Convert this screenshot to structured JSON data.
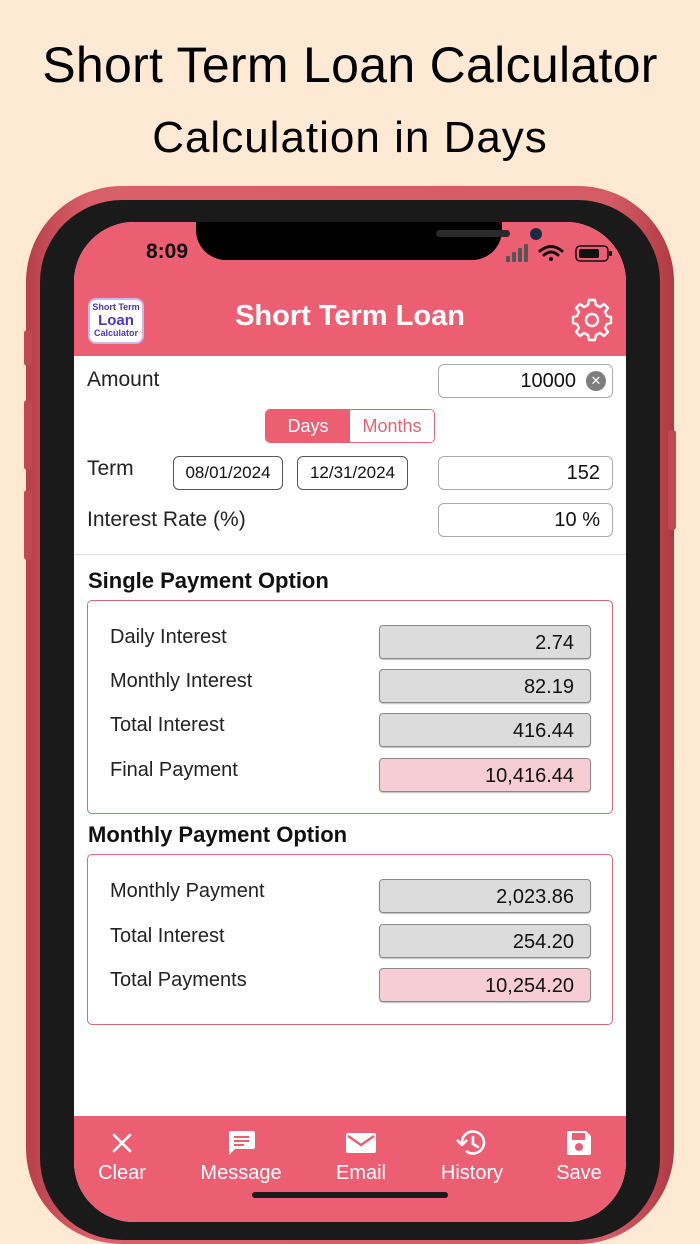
{
  "promo": {
    "title": "Short Term Loan Calculator",
    "subtitle": "Calculation in Days"
  },
  "status_bar": {
    "time": "8:09"
  },
  "header": {
    "title": "Short Term Loan",
    "logo_lines": [
      "Short Term",
      "Loan",
      "Calculator"
    ]
  },
  "form": {
    "amount_label": "Amount",
    "amount_value": "10000",
    "segment": {
      "options": [
        "Days",
        "Months"
      ],
      "selected": "Days"
    },
    "term_label": "Term",
    "start_date": "08/01/2024",
    "end_date": "12/31/2024",
    "term_days": "152",
    "rate_label": "Interest Rate (%)",
    "rate_value": "10 %"
  },
  "single_payment": {
    "title": "Single Payment Option",
    "rows": [
      {
        "label": "Daily Interest",
        "value": "2.74"
      },
      {
        "label": "Monthly Interest",
        "value": "82.19"
      },
      {
        "label": "Total Interest",
        "value": "416.44"
      },
      {
        "label": "Final Payment",
        "value": "10,416.44"
      }
    ]
  },
  "monthly_payment": {
    "title": "Monthly Payment Option",
    "rows": [
      {
        "label": "Monthly Payment",
        "value": "2,023.86"
      },
      {
        "label": "Total Interest",
        "value": "254.20"
      },
      {
        "label": "Total Payments",
        "value": "10,254.20"
      }
    ]
  },
  "tabbar": {
    "items": [
      {
        "label": "Clear",
        "icon": "close-icon"
      },
      {
        "label": "Message",
        "icon": "message-icon"
      },
      {
        "label": "Email",
        "icon": "email-icon"
      },
      {
        "label": "History",
        "icon": "history-icon"
      },
      {
        "label": "Save",
        "icon": "save-icon"
      }
    ]
  },
  "colors": {
    "accent": "#ec5f73",
    "background": "#fde9d4",
    "phone_frame": "#d45c66",
    "result_box": "#dcdcdc",
    "highlight_box": "#f6cdd4"
  }
}
